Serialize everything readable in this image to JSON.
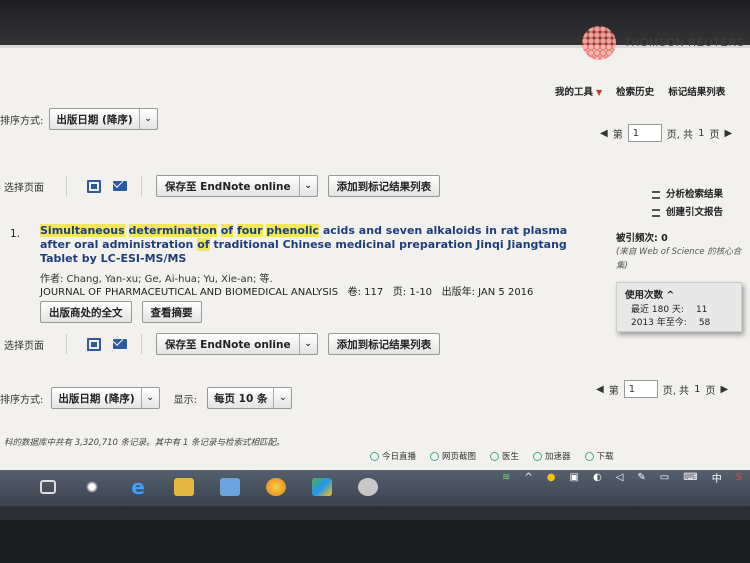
{
  "brand": {
    "name": "THOMSON REUTERS"
  },
  "toolbar": {
    "my_tools": "我的工具",
    "search_history": "检索历史",
    "marked_list": "标记结果列表"
  },
  "sort": {
    "label": "排序方式:",
    "value": "出版日期 (降序)"
  },
  "pager_top": {
    "page_label": "第",
    "page_value": "1",
    "of_label": "页, 共",
    "total": "1",
    "page_suffix": "页"
  },
  "actions": {
    "select_page": "选择页面",
    "save_endnote": "保存至 EndNote online",
    "add_marked": "添加到标记结果列表"
  },
  "side": {
    "analyze": "分析检索结果",
    "citation_report": "创建引文报告"
  },
  "record": {
    "number": "1.",
    "title_parts": [
      {
        "text": "Simultaneous",
        "hl": true
      },
      {
        "text": " ",
        "hl": false
      },
      {
        "text": "determination",
        "hl": true
      },
      {
        "text": " ",
        "hl": false
      },
      {
        "text": "of",
        "hl": true
      },
      {
        "text": " ",
        "hl": false
      },
      {
        "text": "four",
        "hl": true
      },
      {
        "text": " ",
        "hl": false
      },
      {
        "text": "phenolic",
        "hl": true
      },
      {
        "text": " acids and seven alkaloids in rat plasma after oral administration ",
        "hl": false
      },
      {
        "text": "of",
        "hl": true
      },
      {
        "text": " traditional Chinese medicinal preparation Jinqi Jiangtang Tablet by LC-ESI-MS/MS",
        "hl": false
      }
    ],
    "authors": "作者: Chang, Yan-xu; Ge, Ai-hua; Yu, Xie-an; 等.",
    "journal": "JOURNAL OF PHARMACEUTICAL AND BIOMEDICAL ANALYSIS",
    "volume": "卷: 117",
    "pages": "页: 1-10",
    "published": "出版年: JAN 5 2016",
    "fulltext_btn": "出版商处的全文",
    "abstract_btn": "查看摘要"
  },
  "citations": {
    "label": "被引频次: 0",
    "source": "(来自 Web of Science 的核心合集)"
  },
  "usage": {
    "header": "使用次数",
    "rows": [
      {
        "k": "最近 180 天:",
        "v": "11"
      },
      {
        "k": "2013 年至今:",
        "v": "58"
      }
    ]
  },
  "bottom": {
    "sort_label": "排序方式:",
    "sort_value": "出版日期 (降序)",
    "show_label": "显示:",
    "per_page": "每页 10 条"
  },
  "status_text": "科的数据库中共有 3,320,710 条记录。其中有 1 条记录与检索式相匹配。",
  "browser_bar": [
    "今日直播",
    "网页截图",
    "医生",
    "加速器",
    "下载"
  ],
  "tray": {
    "time": "中"
  }
}
